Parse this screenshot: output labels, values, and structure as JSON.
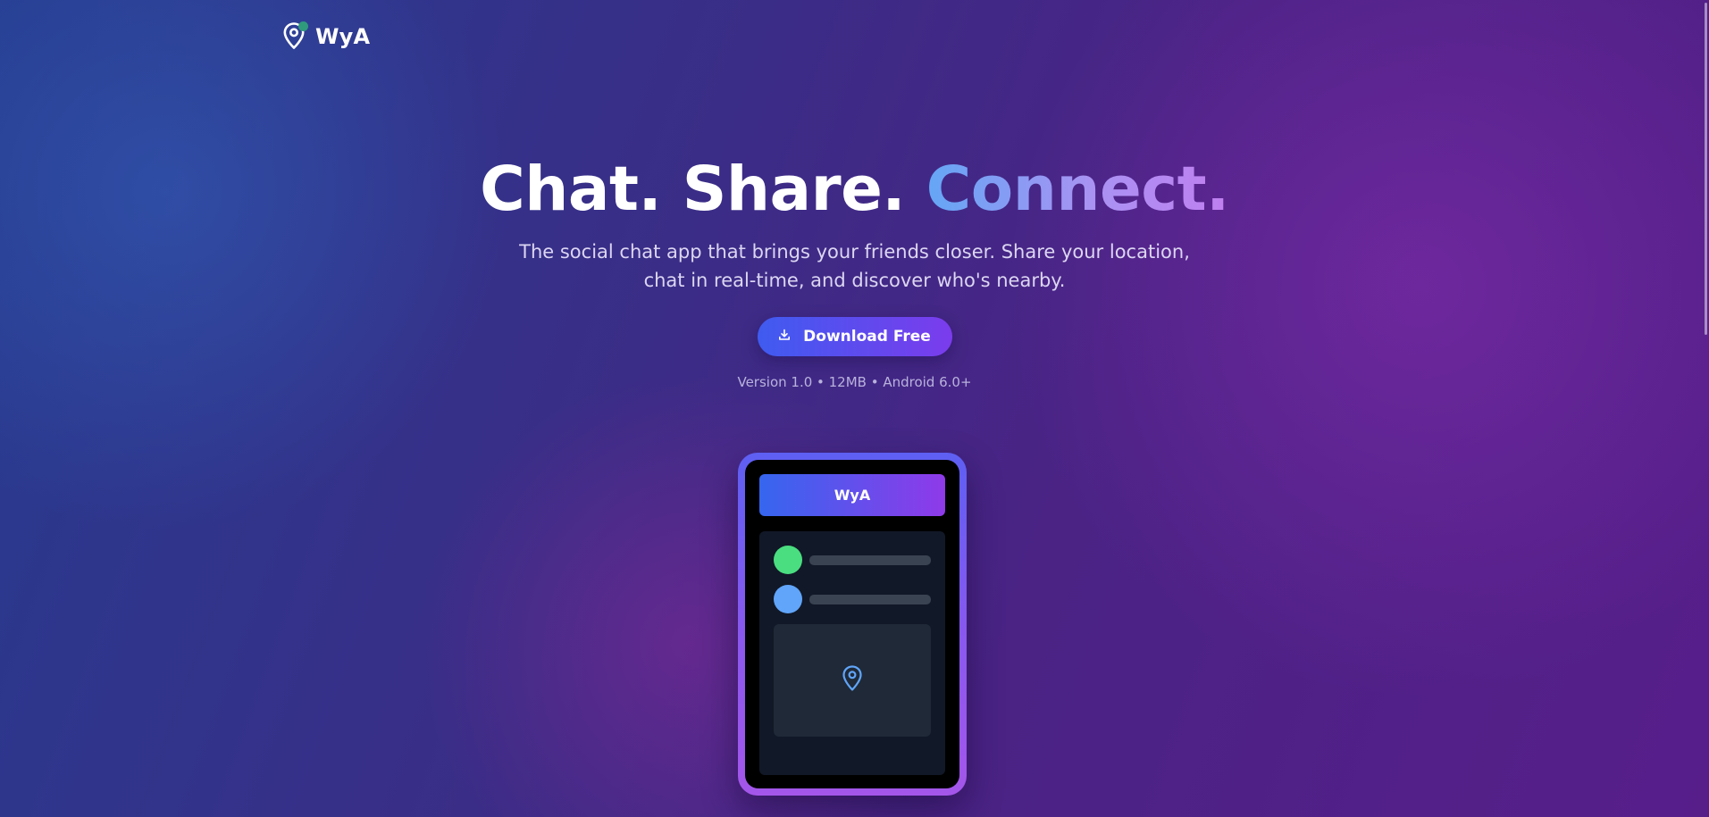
{
  "header": {
    "brand": "WyA",
    "logo_icon": "map-pin-icon",
    "status_dot_color": "#2f9a7c"
  },
  "hero": {
    "headline_part1": "Chat. Share.",
    "headline_accent": "Connect.",
    "subtitle": "The social chat app that brings your friends closer. Share your location, chat in real-time, and discover who's nearby.",
    "download_button": {
      "label": "Download Free",
      "icon": "download-icon"
    },
    "version_info": "Version 1.0 • 12MB • Android 6.0+"
  },
  "phone": {
    "app_title": "WyA",
    "contacts": [
      {
        "avatar_color": "#4ade80"
      },
      {
        "avatar_color": "#60a5fa"
      }
    ],
    "map_icon": "map-pin-icon"
  },
  "colors": {
    "accent_gradient_start": "#3f5bf0",
    "accent_gradient_end": "#7b3ced",
    "map_pin": "#60a5fa"
  }
}
